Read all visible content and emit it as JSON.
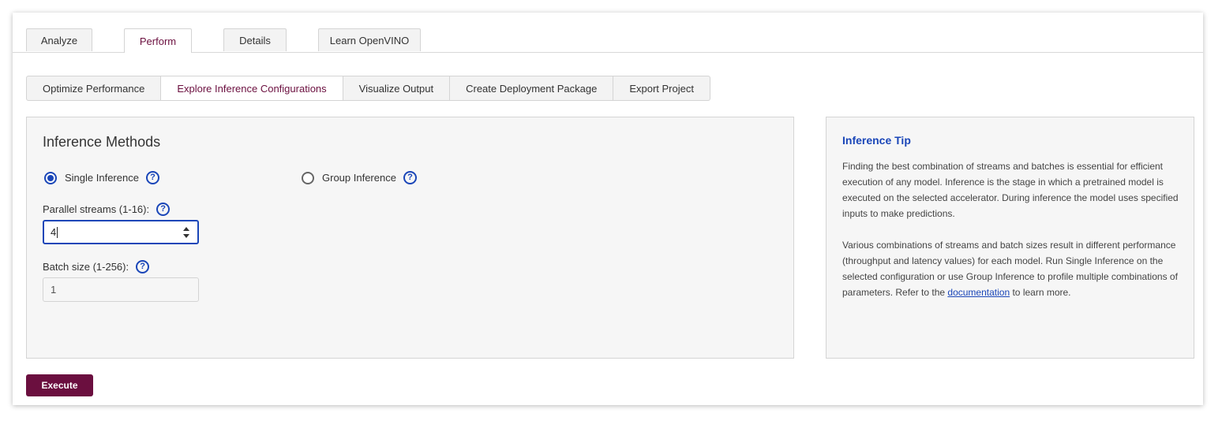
{
  "top_tabs": [
    {
      "label": "Analyze",
      "active": false
    },
    {
      "label": "Perform",
      "active": true
    },
    {
      "label": "Details",
      "active": false
    },
    {
      "label": "Learn OpenVINO",
      "active": false
    }
  ],
  "sub_tabs": [
    {
      "label": "Optimize Performance",
      "active": false
    },
    {
      "label": "Explore Inference Configurations",
      "active": true
    },
    {
      "label": "Visualize Output",
      "active": false
    },
    {
      "label": "Create Deployment Package",
      "active": false
    },
    {
      "label": "Export Project",
      "active": false
    }
  ],
  "inference": {
    "title": "Inference Methods",
    "single_label": "Single Inference",
    "group_label": "Group Inference",
    "selected": "single",
    "streams_label": "Parallel streams (1-16):",
    "streams_value": "4",
    "batch_label": "Batch size (1-256):",
    "batch_value": "1"
  },
  "tip": {
    "title": "Inference Tip",
    "paragraph1": "Finding the best combination of streams and batches is essential for efficient execution of any model. Inference is the stage in which a pretrained model is executed on the selected accelerator. During inference the model uses specified inputs to make predictions.",
    "paragraph2_before": "Various combinations of streams and batch sizes result in different performance (throughput and latency values) for each model. Run Single Inference on the selected configuration or use Group Inference to profile multiple combinations of parameters. Refer to the ",
    "paragraph2_link": "documentation",
    "paragraph2_after": " to learn more."
  },
  "execute_label": "Execute",
  "icons": {
    "help": "help-circle-icon",
    "spinner": "spinner-arrows-icon"
  },
  "colors": {
    "accent": "#6b0f3f",
    "link_blue": "#1a46b8"
  }
}
